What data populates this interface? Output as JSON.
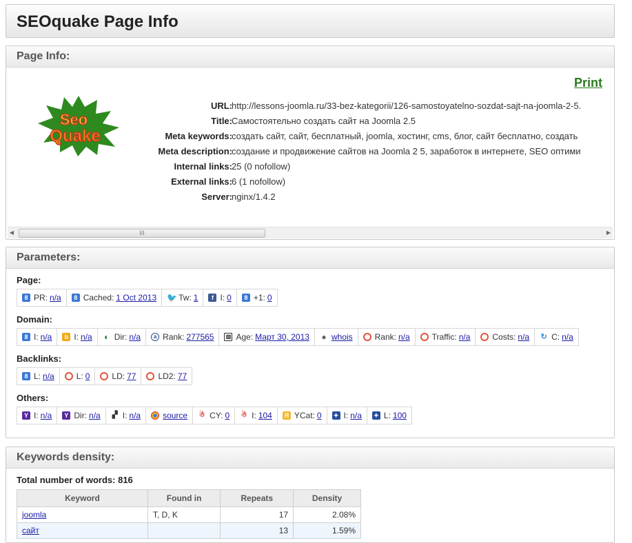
{
  "header": {
    "title": "SEOquake Page Info"
  },
  "page_info": {
    "title": "Page Info:",
    "print_label": "Print",
    "logo_text_top": "Seo",
    "logo_text_bottom": "Quake",
    "rows": [
      {
        "label": "URL:",
        "value": "http://lessons-joomla.ru/33-bez-kategorii/126-samostoyatelno-sozdat-sajt-na-joomla-2-5."
      },
      {
        "label": "Title:",
        "value": "Самостоятельно создать сайт на Joomla 2.5"
      },
      {
        "label": "Meta keywords:",
        "value": "создать сайт, сайт, бесплатный, joomla, хостинг, cms, блог, сайт бесплатно, создать"
      },
      {
        "label": "Meta description:",
        "value": "создание и продвижение сайтов на Joomla 2 5, заработок в интернете, SEO оптими"
      },
      {
        "label": "Internal links:",
        "value": "25 (0 nofollow)"
      },
      {
        "label": "External links:",
        "value": "6 (1 nofollow)"
      },
      {
        "label": "Server:",
        "value": "nginx/1.4.2"
      }
    ],
    "scroll_thumb_grip": "III"
  },
  "parameters": {
    "title": "Parameters:",
    "groups": [
      {
        "title": "Page:",
        "items": [
          {
            "icon": "google-icon",
            "glyph": "8",
            "label": "PR:",
            "value": "n/a"
          },
          {
            "icon": "google-icon",
            "glyph": "8",
            "label": "Cached:",
            "value": "1 Oct 2013"
          },
          {
            "icon": "twitter-icon",
            "glyph": "🐦",
            "label": "Tw:",
            "value": "1"
          },
          {
            "icon": "facebook-icon",
            "glyph": "f",
            "label": "I:",
            "value": "0"
          },
          {
            "icon": "google-icon",
            "glyph": "8",
            "label": "+1:",
            "value": "0"
          }
        ]
      },
      {
        "title": "Domain:",
        "items": [
          {
            "icon": "google-icon",
            "glyph": "8",
            "label": "I:",
            "value": "n/a"
          },
          {
            "icon": "bing-icon",
            "glyph": "b",
            "label": "I:",
            "value": "n/a"
          },
          {
            "icon": "dmoz-icon",
            "glyph": "◐",
            "label": "Dir:",
            "value": "n/a"
          },
          {
            "icon": "alexa-icon",
            "glyph": "a",
            "label": "Rank:",
            "value": "277565"
          },
          {
            "icon": "webarchive-icon",
            "glyph": "▥",
            "label": "Age:",
            "value": "Март 30, 2013"
          },
          {
            "icon": "whois-icon",
            "glyph": "●",
            "label": "",
            "value": "whois"
          },
          {
            "icon": "semrush-icon",
            "glyph": "",
            "label": "Rank:",
            "value": "n/a"
          },
          {
            "icon": "semrush-icon",
            "glyph": "",
            "label": "Traffic:",
            "value": "n/a"
          },
          {
            "icon": "semrush-icon",
            "glyph": "",
            "label": "Costs:",
            "value": "n/a"
          },
          {
            "icon": "compete-icon",
            "glyph": "↻",
            "label": "C:",
            "value": "n/a"
          }
        ]
      },
      {
        "title": "Backlinks:",
        "items": [
          {
            "icon": "google-icon",
            "glyph": "8",
            "label": "L:",
            "value": "n/a"
          },
          {
            "icon": "semrush-icon",
            "glyph": "",
            "label": "L:",
            "value": "0"
          },
          {
            "icon": "semrush-icon",
            "glyph": "",
            "label": "LD:",
            "value": "77"
          },
          {
            "icon": "semrush-icon",
            "glyph": "",
            "label": "LD2:",
            "value": "77"
          }
        ]
      },
      {
        "title": "Others:",
        "items": [
          {
            "icon": "yahoo-icon",
            "glyph": "Y",
            "label": "I:",
            "value": "n/a"
          },
          {
            "icon": "yahoo-icon",
            "glyph": "Y",
            "label": "Dir:",
            "value": "n/a"
          },
          {
            "icon": "delicious-icon",
            "glyph": "▞",
            "label": "I:",
            "value": "n/a"
          },
          {
            "icon": "chrome-icon",
            "glyph": "",
            "label": "",
            "value": "source"
          },
          {
            "icon": "yandex-cy-icon",
            "glyph": "☃",
            "label": "CY:",
            "value": "0"
          },
          {
            "icon": "yandex-cy-icon",
            "glyph": "☃",
            "label": "I:",
            "value": "104"
          },
          {
            "icon": "yandex-catalog-icon",
            "glyph": "Я",
            "label": "YCat:",
            "value": "0"
          },
          {
            "icon": "sitescore-icon",
            "glyph": "✦",
            "label": "I:",
            "value": "n/a"
          },
          {
            "icon": "sitescore-icon",
            "glyph": "✦",
            "label": "L:",
            "value": "100"
          }
        ]
      }
    ]
  },
  "keywords": {
    "title": "Keywords density:",
    "total_label": "Total number of words: 816",
    "columns": [
      "Keyword",
      "Found in",
      "Repeats",
      "Density"
    ],
    "rows": [
      {
        "keyword": "joomla",
        "found_in": "T, D, K",
        "repeats": "17",
        "density": "2.08%"
      },
      {
        "keyword": "сайт",
        "found_in": "",
        "repeats": "13",
        "density": "1.59%"
      }
    ]
  }
}
